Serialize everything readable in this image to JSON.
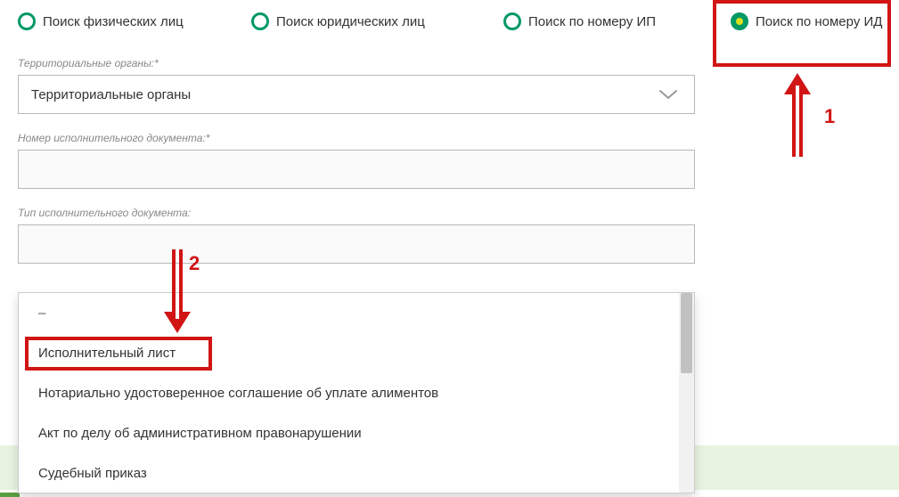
{
  "tabs": [
    {
      "label": "Поиск физических лиц",
      "selected": false
    },
    {
      "label": "Поиск юридических лиц",
      "selected": false
    },
    {
      "label": "Поиск по номеру ИП",
      "selected": false
    },
    {
      "label": "Поиск по номеру ИД",
      "selected": true
    }
  ],
  "fields": {
    "territory": {
      "label": "Территориальные органы:*",
      "value": "Территориальные органы"
    },
    "doc_number": {
      "label": "Номер исполнительного документа:*",
      "value": ""
    },
    "doc_type": {
      "label": "Тип исполнительного документа:",
      "value": ""
    }
  },
  "dropdown": {
    "items": [
      "–",
      "Исполнительный лист",
      "Нотариально удостоверенное соглашение об уплате алиментов",
      "Акт по делу об административном правонарушении",
      "Судебный приказ"
    ]
  },
  "annotations": {
    "a1": "1",
    "a2": "2"
  }
}
